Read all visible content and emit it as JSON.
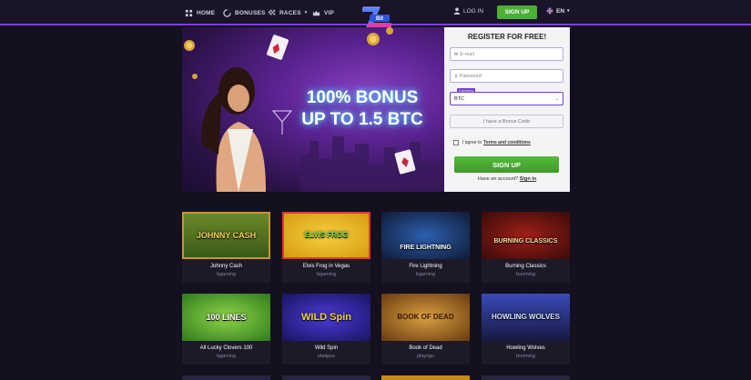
{
  "header": {
    "nav": [
      {
        "label": "HOME",
        "icon": "home-icon"
      },
      {
        "label": "BONUSES",
        "icon": "bonus-icon",
        "dropdown": true
      },
      {
        "label": "RACES",
        "icon": "flag-icon",
        "dropdown": true
      },
      {
        "label": "VIP",
        "icon": "crown-icon"
      }
    ],
    "login_label": "LOG IN",
    "signup_label": "SIGN UP",
    "language": "EN"
  },
  "hero": {
    "line1": "100% BONUS",
    "line2": "UP TO 1.5 BTC"
  },
  "register": {
    "title": "REGISTER FOR FREE!",
    "email_placeholder": "E-mail",
    "password_placeholder": "Password",
    "currency_label": "Currency",
    "currency_value": "BTC",
    "bonus_code_label": "I have a Bonus Code",
    "agree_text": "I agree to",
    "terms_link": "Terms and conditions",
    "signup_button": "SIGN UP",
    "have_account": "Have an account?",
    "signin_link": "Sign in"
  },
  "games": [
    {
      "name": "Johnny Cash",
      "provider": "bgaming",
      "art": "JOHNNY CASH"
    },
    {
      "name": "Elvis Frog in Vegas",
      "provider": "bgaming",
      "art": "ELVIS FROG"
    },
    {
      "name": "Fire Lightning",
      "provider": "bgaming",
      "art": "FIRE LIGHTNING"
    },
    {
      "name": "Burning Classics",
      "provider": "booming",
      "art": "BURNING CLASSICS"
    },
    {
      "name": "All Lucky Clovers 100",
      "provider": "bgaming",
      "art": "100 LINES"
    },
    {
      "name": "Wild Spin",
      "provider": "platipus",
      "art": "WILD Spin"
    },
    {
      "name": "Book of Dead",
      "provider": "playngo",
      "art": "BOOK OF DEAD"
    },
    {
      "name": "Howling Wolves",
      "provider": "booming",
      "art": "HOWLING WOLVES"
    }
  ],
  "colors": {
    "accent": "#7b3fe0",
    "green": "#4caf34",
    "background": "#14101f"
  }
}
